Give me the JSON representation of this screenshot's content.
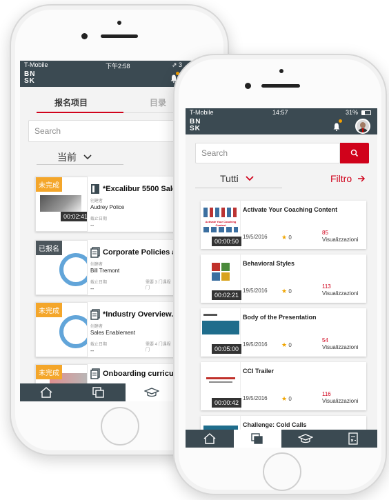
{
  "back_phone": {
    "status": {
      "carrier": "T-Mobile",
      "time": "下午2:58",
      "location": "⇗ 3"
    },
    "logo": "BN\nSK",
    "tabs": [
      {
        "label": "报名项目"
      },
      {
        "label": "目录"
      }
    ],
    "search": {
      "placeholder": "Search"
    },
    "filter": {
      "label": "当前"
    },
    "cards": [
      {
        "tag": "未完成",
        "title": "*Excalibur 5500 Sales",
        "meta_label": "创建者",
        "author": "Audrey Police",
        "due_label": "截止日期",
        "due_value": "--",
        "time": "00:02:41"
      },
      {
        "tag": "已报名",
        "title": "Corporate Policies an",
        "meta_label": "创建者",
        "author": "Bill Tremont",
        "due_label": "截止日期",
        "due_value": "--",
        "extra": "需要 3 门课程",
        "extra2": "门"
      },
      {
        "tag": "未完成",
        "title": "*Industry Overview...",
        "meta_label": "创建者",
        "author": "Sales Enablement",
        "due_label": "截止日期",
        "due_value": "--",
        "extra": "需要 4 门课程",
        "extra2": "门"
      },
      {
        "tag": "未完成",
        "title": "Onboarding curriculu"
      }
    ]
  },
  "front_phone": {
    "status": {
      "carrier": "T-Mobile",
      "time": "14:57",
      "battery": "31%"
    },
    "logo": "BN\nSK",
    "search": {
      "placeholder": "Search"
    },
    "filter": {
      "label": "Tutti",
      "action": "Filtro"
    },
    "items": [
      {
        "title": "Activate Your Coaching Content",
        "thumb_caption": "Activate Your Coaching Content",
        "time": "00:00:50",
        "date": "19/5/2016",
        "rating": "0",
        "views": "85",
        "views_label": "Visualizzazioni"
      },
      {
        "title": "Behavioral Styles",
        "time": "00:02:21",
        "date": "19/5/2016",
        "rating": "0",
        "views": "113",
        "views_label": "Visualizzazioni"
      },
      {
        "title": "Body of the Presentation",
        "time": "00:05:00",
        "date": "19/5/2016",
        "rating": "0",
        "views": "54",
        "views_label": "Visualizzazioni"
      },
      {
        "title": "CCI Trailer",
        "time": "00:00:42",
        "date": "19/5/2016",
        "rating": "0",
        "views": "116",
        "views_label": "Visualizzazioni"
      },
      {
        "title": "Challenge: Cold Calls"
      }
    ]
  },
  "colors": {
    "header": "#3b4a52",
    "accent_red": "#d0021b",
    "tag_orange": "#f4a62a",
    "tag_gray": "#4c565c",
    "star": "#f0a500"
  },
  "icons": [
    "home-icon",
    "copy-icon",
    "graduation-cap-icon",
    "calculator-icon",
    "search-icon",
    "bell-icon",
    "chevron-down-icon",
    "arrow-right-icon"
  ]
}
